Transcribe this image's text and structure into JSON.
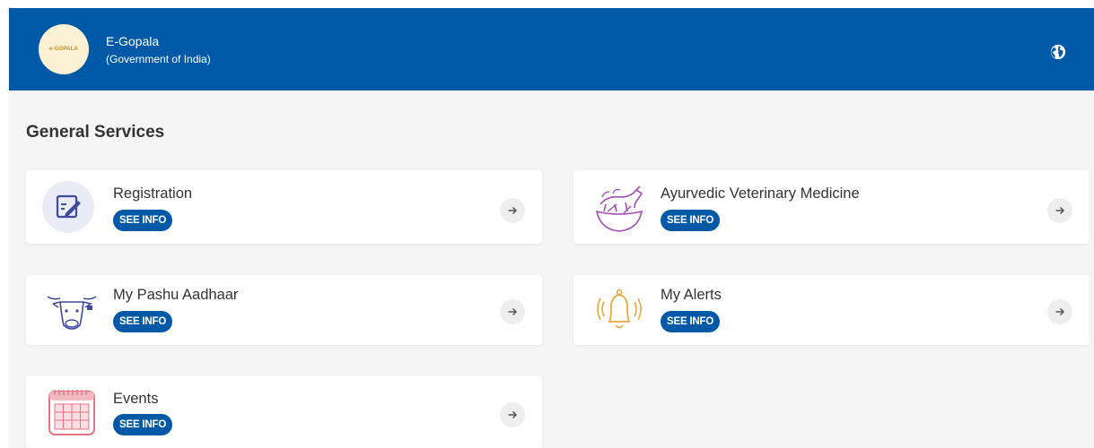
{
  "header": {
    "logo_text": "e-GOPALA",
    "title": "E-Gopala",
    "subtitle": "(Government of India)",
    "globe_icon": "globe-icon"
  },
  "section": {
    "title": "General Services"
  },
  "cards": [
    {
      "title": "Registration",
      "button": "SEE INFO",
      "icon": "registration-icon"
    },
    {
      "title": "Ayurvedic Veterinary Medicine",
      "button": "SEE INFO",
      "icon": "cow-bowl-icon"
    },
    {
      "title": "My Pashu Aadhaar",
      "button": "SEE INFO",
      "icon": "cow-face-icon"
    },
    {
      "title": "My Alerts",
      "button": "SEE INFO",
      "icon": "bell-icon"
    },
    {
      "title": "Events",
      "button": "SEE INFO",
      "icon": "calendar-icon"
    }
  ],
  "colors": {
    "header": "#0059a6",
    "button": "#0059a6",
    "background": "#f5f5f5"
  }
}
